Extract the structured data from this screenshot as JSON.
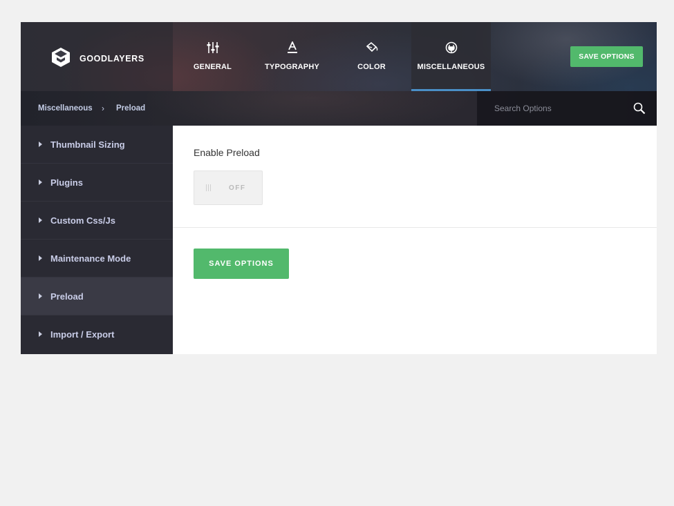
{
  "brand": {
    "name": "GOODLAYERS",
    "icon": "goodlayers-logo-icon"
  },
  "nav": {
    "tabs": [
      {
        "label": "GENERAL",
        "icon": "sliders-icon"
      },
      {
        "label": "TYPOGRAPHY",
        "icon": "font-a-icon"
      },
      {
        "label": "COLOR",
        "icon": "paint-bucket-icon"
      },
      {
        "label": "MISCELLANEOUS",
        "icon": "plug-icon",
        "active": true
      }
    ],
    "save_label": "SAVE OPTIONS"
  },
  "breadcrumb": {
    "parent": "Miscellaneous",
    "separator": "›",
    "current": "Preload"
  },
  "search": {
    "placeholder": "Search Options",
    "icon": "search-icon"
  },
  "sidebar": {
    "items": [
      {
        "label": "Thumbnail Sizing"
      },
      {
        "label": "Plugins"
      },
      {
        "label": "Custom Css/Js"
      },
      {
        "label": "Maintenance Mode"
      },
      {
        "label": "Preload",
        "active": true
      },
      {
        "label": "Import / Export"
      }
    ]
  },
  "content": {
    "option_label": "Enable Preload",
    "toggle_state": "OFF",
    "save_label": "SAVE OPTIONS"
  },
  "colors": {
    "accent_green": "#52b96c",
    "active_tab_underline": "#4a8fc7",
    "sidebar_bg": "#2a2a33"
  }
}
